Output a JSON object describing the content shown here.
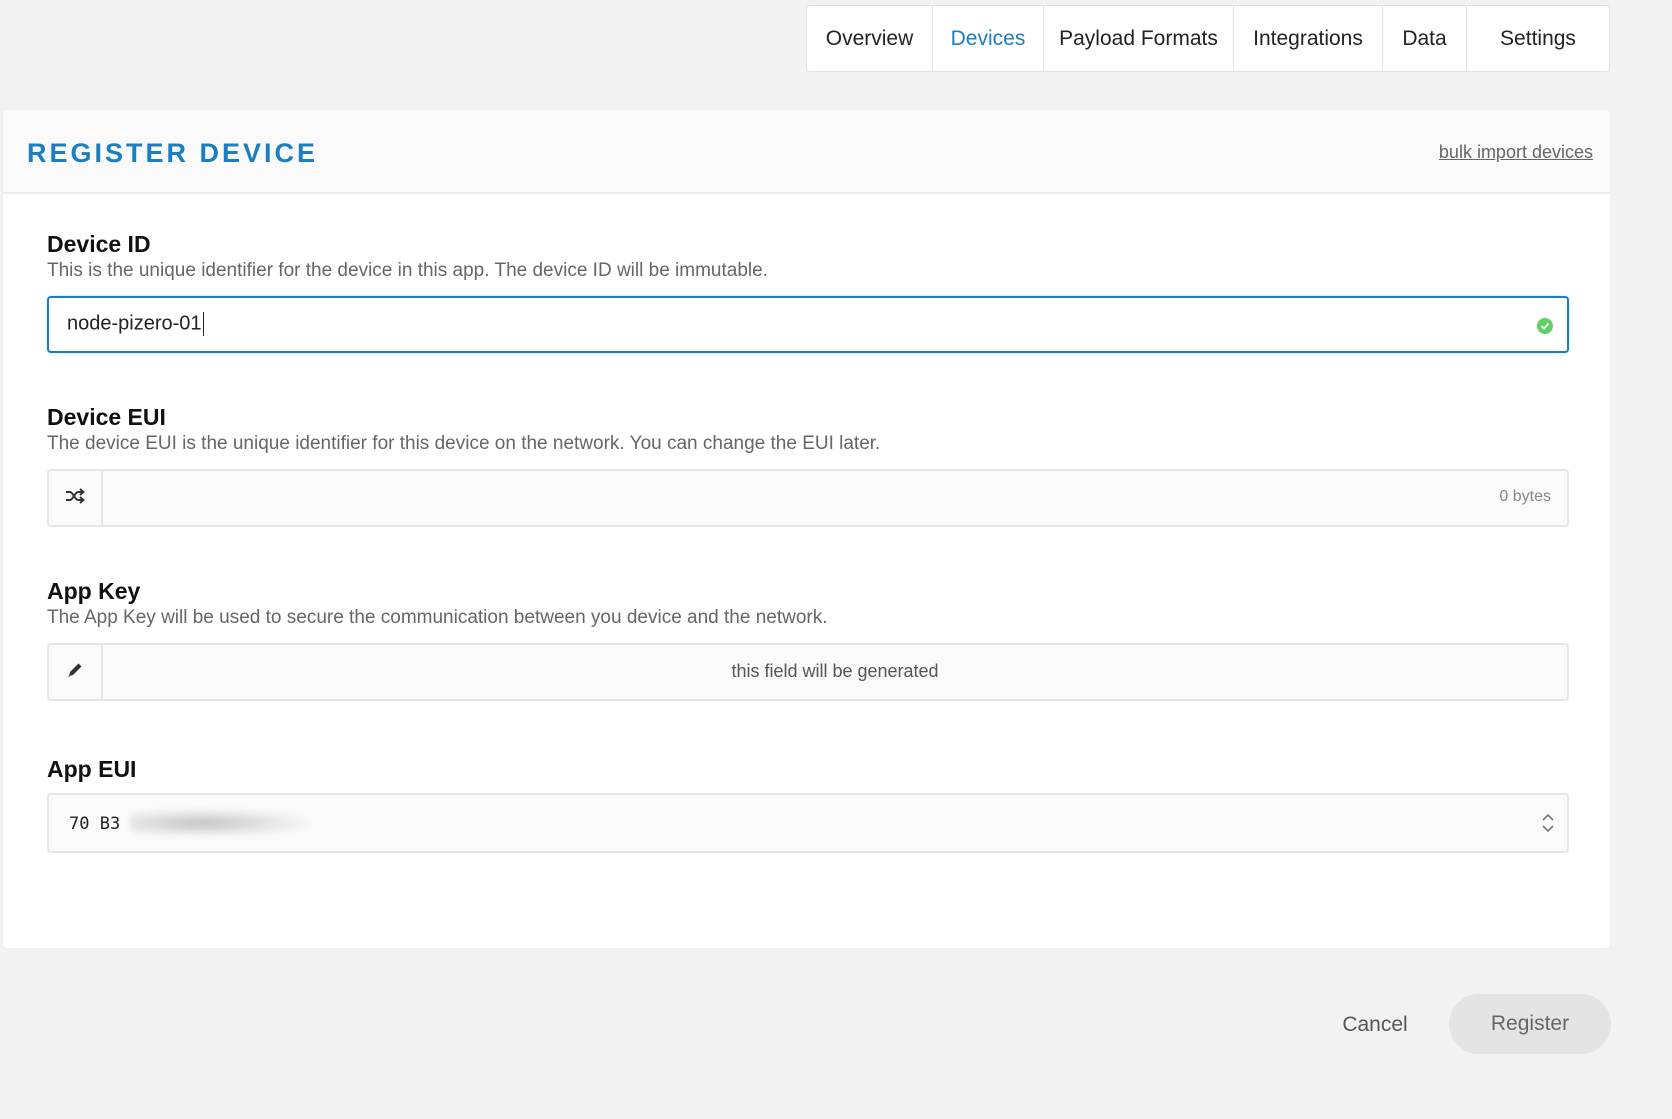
{
  "tabs": [
    {
      "label": "Overview"
    },
    {
      "label": "Devices"
    },
    {
      "label": "Payload Formats"
    },
    {
      "label": "Integrations"
    },
    {
      "label": "Data"
    },
    {
      "label": "Settings"
    }
  ],
  "active_tab": "Devices",
  "card": {
    "title": "REGISTER DEVICE",
    "bulk_link": "bulk import devices"
  },
  "form": {
    "device_id": {
      "label": "Device ID",
      "description": "This is the unique identifier for the device in this app. The device ID will be immutable.",
      "value": "node-pizero-01",
      "valid_icon": "check-circle-icon"
    },
    "device_eui": {
      "label": "Device EUI",
      "description": "The device EUI is the unique identifier for this device on the network. You can change the EUI later.",
      "value": "",
      "bytes": "0 bytes",
      "icon": "shuffle-icon"
    },
    "app_key": {
      "label": "App Key",
      "description": "The App Key will be used to secure the communication between you device and the network.",
      "placeholder": "this field will be generated",
      "icon": "pencil-icon"
    },
    "app_eui": {
      "label": "App EUI",
      "value": "70 B3",
      "icon": "select-arrows-icon"
    }
  },
  "actions": {
    "cancel": "Cancel",
    "register": "Register"
  },
  "colors": {
    "accent": "#1a7fc1",
    "valid": "#5fcf66",
    "background": "#f2f2f2"
  }
}
